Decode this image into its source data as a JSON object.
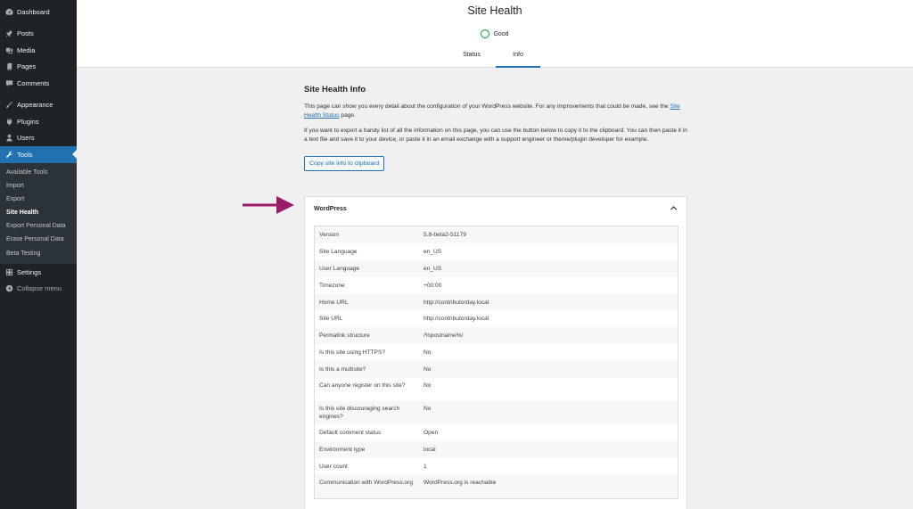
{
  "sidebar": {
    "top": [
      {
        "label": "Dashboard",
        "icon": "dashboard-icon"
      }
    ],
    "group1": [
      {
        "label": "Posts",
        "icon": "pin-icon"
      },
      {
        "label": "Media",
        "icon": "media-icon"
      },
      {
        "label": "Pages",
        "icon": "pages-icon"
      },
      {
        "label": "Comments",
        "icon": "comment-icon"
      }
    ],
    "group2": [
      {
        "label": "Appearance",
        "icon": "brush-icon"
      },
      {
        "label": "Plugins",
        "icon": "plugin-icon"
      },
      {
        "label": "Users",
        "icon": "user-icon"
      },
      {
        "label": "Tools",
        "icon": "wrench-icon"
      }
    ],
    "tools_sub": [
      "Available Tools",
      "Import",
      "Export",
      "Site Health",
      "Export Personal Data",
      "Erase Personal Data",
      "Beta Testing"
    ],
    "settings": "Settings",
    "collapse": "Collapse menu"
  },
  "header": {
    "title": "Site Health",
    "status": "Good",
    "tabs": [
      "Status",
      "Info"
    ]
  },
  "content": {
    "heading": "Site Health Info",
    "p1_before": "This page can show you every detail about the configuration of your WordPress website. For any improvements that could be made, see the ",
    "p1_link": "Site Health Status",
    "p1_after": " page.",
    "p2": "If you want to export a handy list of all the information on this page, you can use the button below to copy it to the clipboard. You can then paste it in a text file and save it to your device, or paste it in an email exchange with a support engineer or theme/plugin developer for example.",
    "copy_button": "Copy site info to clipboard"
  },
  "panel": {
    "title": "WordPress",
    "rows": [
      {
        "k": "Version",
        "v": "5.8-beta2-51179"
      },
      {
        "k": "Site Language",
        "v": "en_US"
      },
      {
        "k": "User Language",
        "v": "en_US"
      },
      {
        "k": "Timezone",
        "v": "+00:00"
      },
      {
        "k": "Home URL",
        "v": "http://contributorday.local"
      },
      {
        "k": "Site URL",
        "v": "http://contributorday.local"
      },
      {
        "k": "Permalink structure",
        "v": "/%postname%/"
      },
      {
        "k": "Is this site using HTTPS?",
        "v": "No"
      },
      {
        "k": "Is this a multisite?",
        "v": "No"
      },
      {
        "k": "Can anyone register on this site?",
        "v": "No"
      },
      {
        "k": "Is this site discouraging search engines?",
        "v": "No"
      },
      {
        "k": "Default comment status",
        "v": "Open"
      },
      {
        "k": "Environment type",
        "v": "local"
      },
      {
        "k": "User count",
        "v": "1"
      },
      {
        "k": "Communication with WordPress.org",
        "v": "WordPress.org is reachable"
      }
    ]
  },
  "colors": {
    "sidebar_bg": "#1d2327",
    "accent": "#2271b1",
    "good": "#00a32a",
    "arrow": "#9b1c6b"
  }
}
